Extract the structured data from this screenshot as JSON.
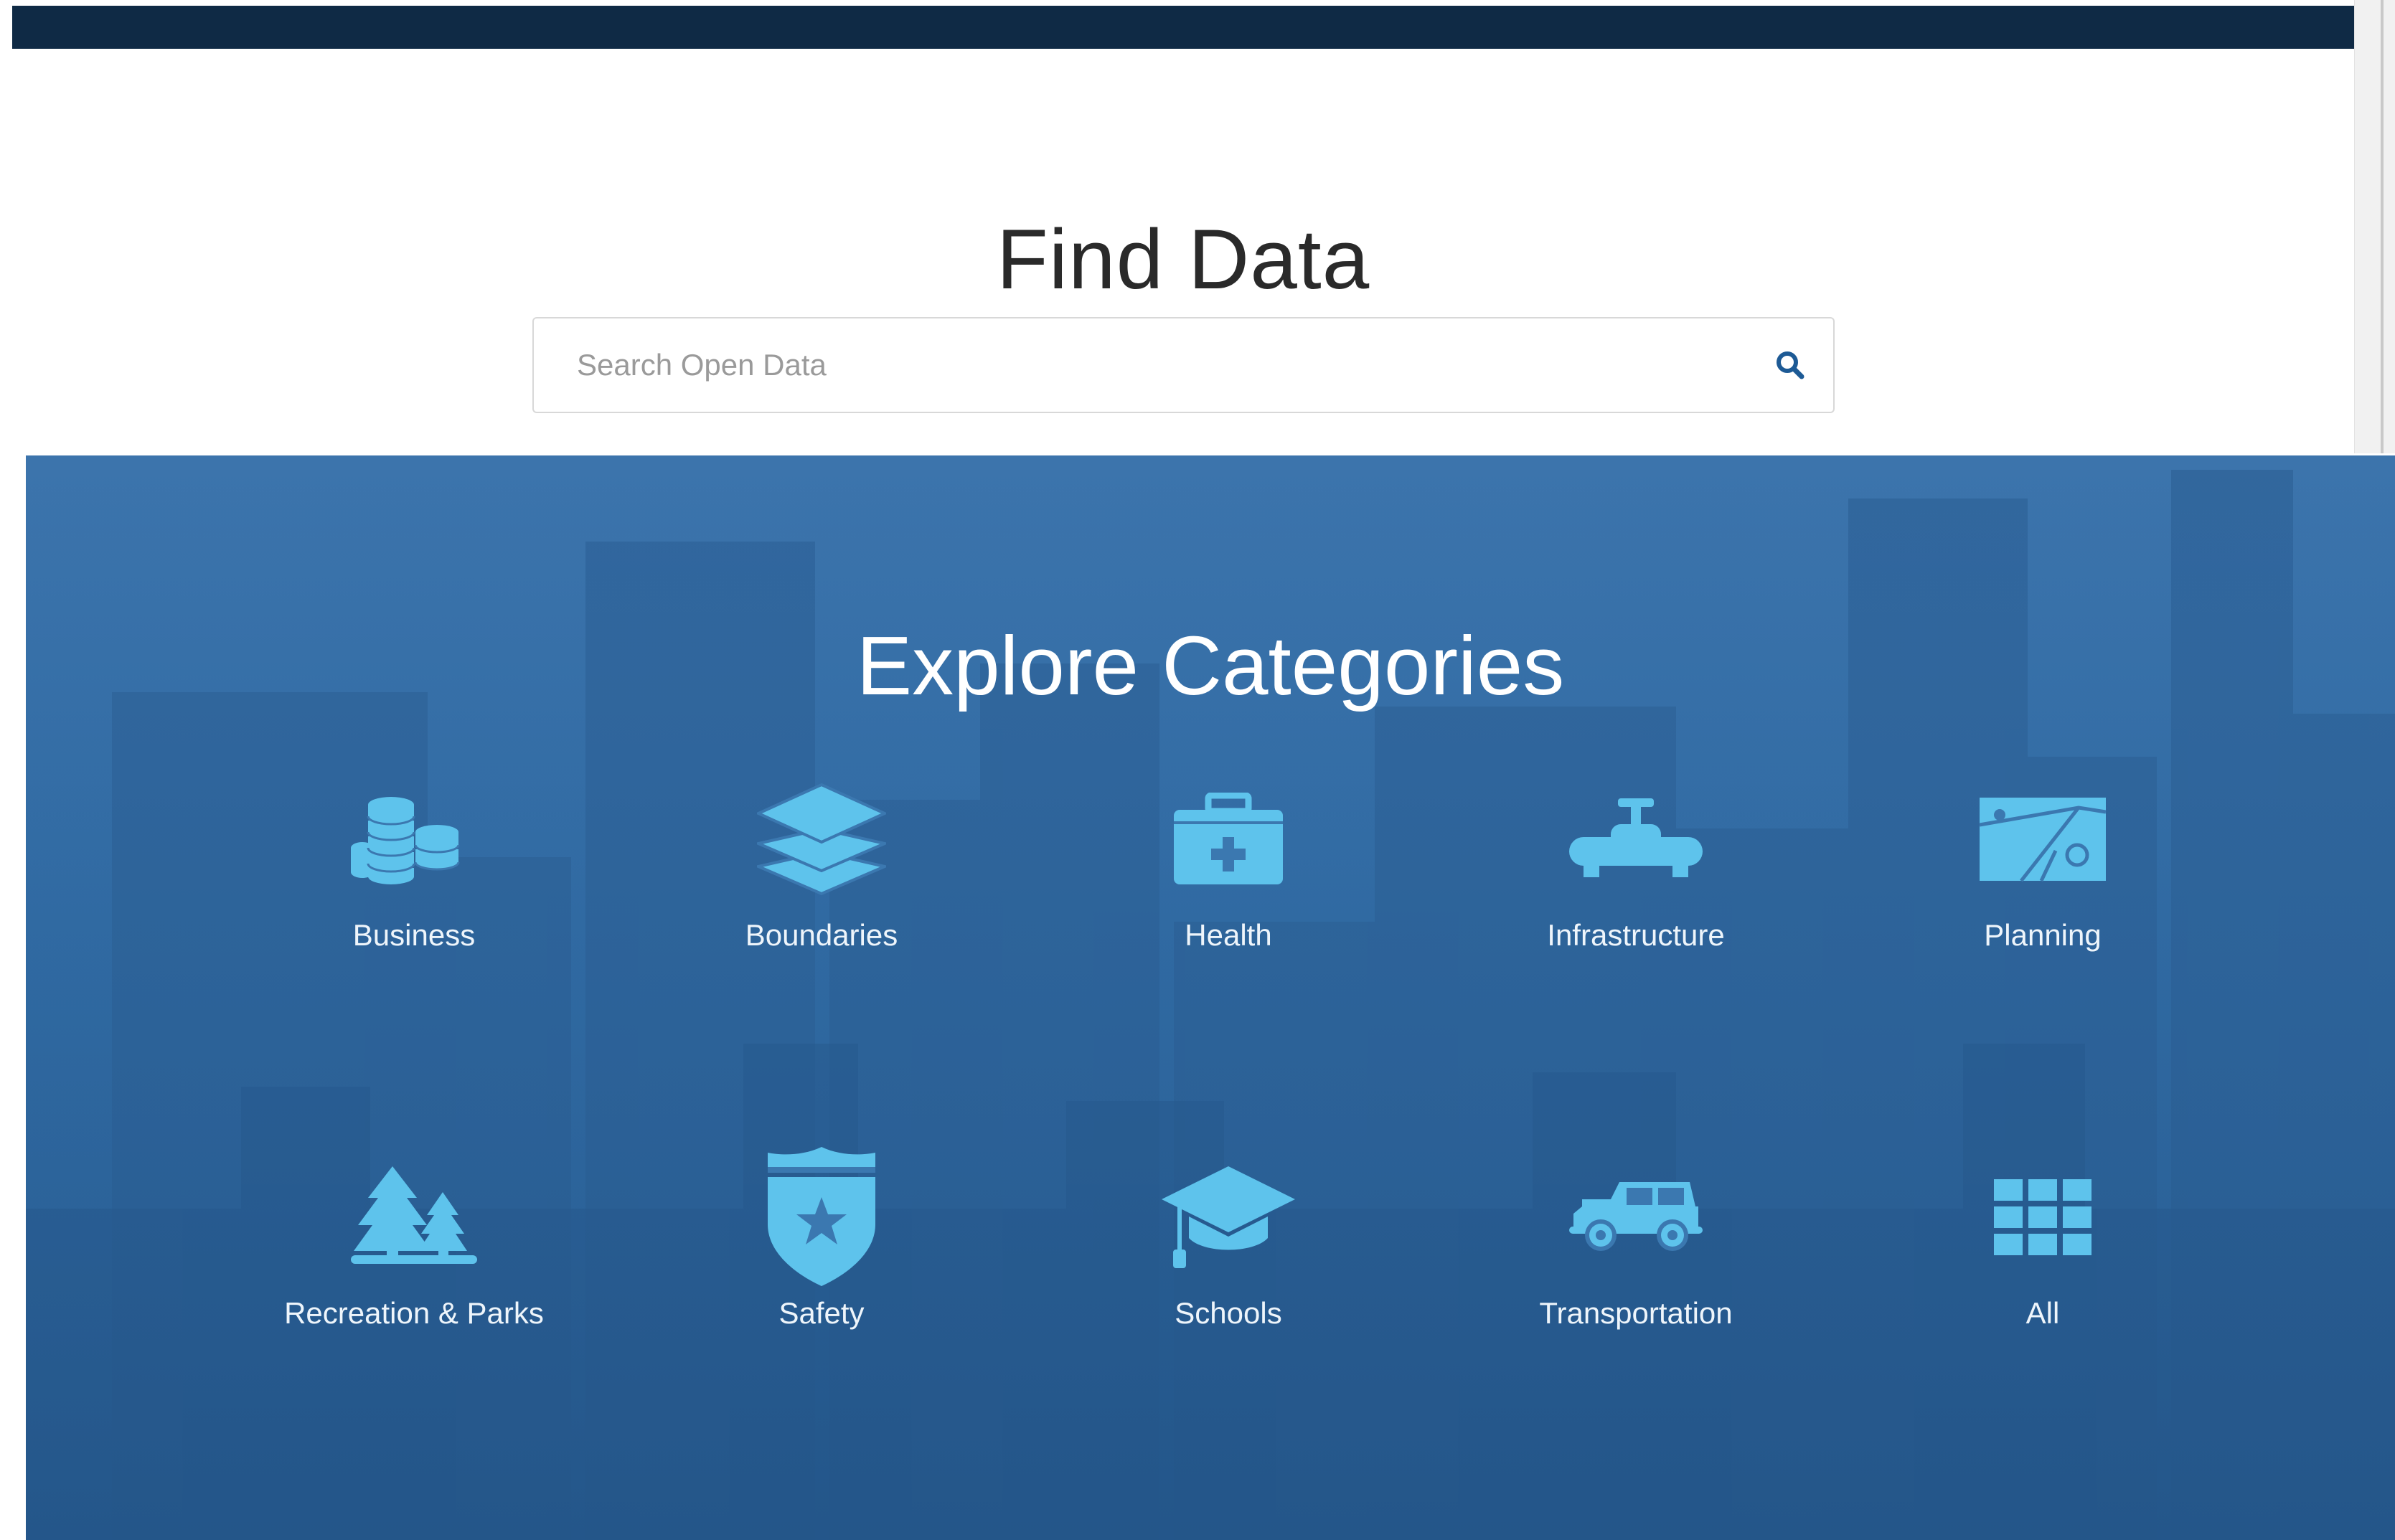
{
  "header": {
    "background": "#0f2a45"
  },
  "find_data": {
    "title": "Find Data",
    "search": {
      "placeholder": "Search Open Data",
      "value": "",
      "icon": "search-icon"
    }
  },
  "explore": {
    "title": "Explore Categories",
    "icon_color": "#5ec3ec",
    "categories": [
      {
        "label": "Business",
        "icon": "coins-icon"
      },
      {
        "label": "Boundaries",
        "icon": "layers-icon"
      },
      {
        "label": "Health",
        "icon": "medical-kit-icon"
      },
      {
        "label": "Infrastructure",
        "icon": "water-valve-icon"
      },
      {
        "label": "Planning",
        "icon": "map-icon"
      },
      {
        "label": "Recreation & Parks",
        "icon": "trees-icon"
      },
      {
        "label": "Safety",
        "icon": "police-badge-icon"
      },
      {
        "label": "Schools",
        "icon": "graduation-cap-icon"
      },
      {
        "label": "Transportation",
        "icon": "jeep-icon"
      },
      {
        "label": "All",
        "icon": "grid-icon"
      }
    ]
  }
}
